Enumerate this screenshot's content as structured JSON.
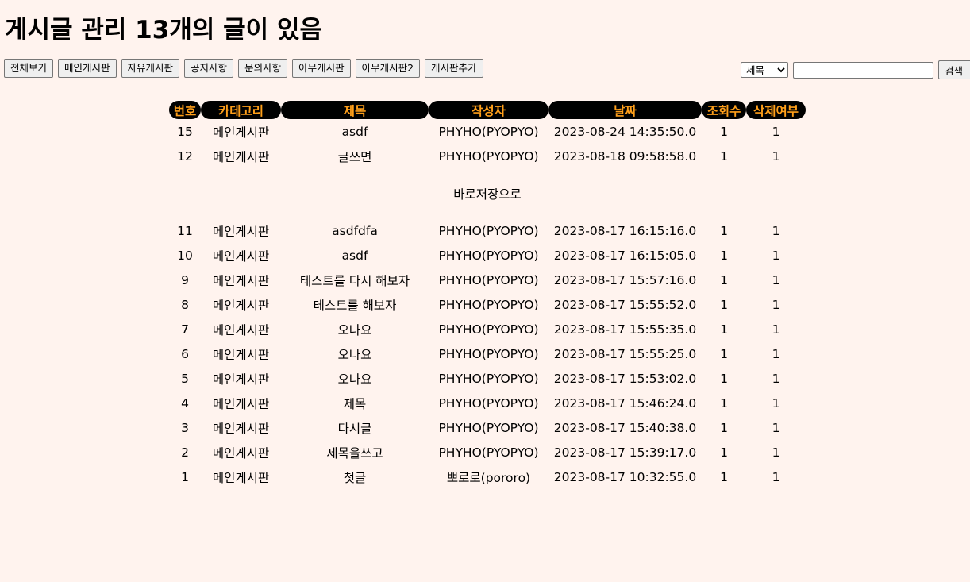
{
  "page": {
    "title": "게시글 관리 13개의 글이 있음"
  },
  "toolbar": {
    "buttons": [
      "전체보기",
      "메인게시판",
      "자유게시판",
      "공지사항",
      "문의사항",
      "아무게시판",
      "아무게시판2",
      "게시판추가"
    ]
  },
  "search": {
    "selected_option": "제목",
    "query": "",
    "button_label": "검색"
  },
  "table": {
    "headers": [
      "번호",
      "카테고리",
      "제목",
      "작성자",
      "날짜",
      "조회수",
      "삭제여부"
    ],
    "rows_top": [
      [
        "15",
        "메인게시판",
        "asdf",
        "PHYHO(PYOPYO)",
        "2023-08-24 14:35:50.0",
        "1",
        "1"
      ],
      [
        "12",
        "메인게시판",
        "글쓰면",
        "PHYHO(PYOPYO)",
        "2023-08-18 09:58:58.0",
        "1",
        "1"
      ]
    ],
    "note": "바로저장으로",
    "rows_bottom": [
      [
        "11",
        "메인게시판",
        "asdfdfa",
        "PHYHO(PYOPYO)",
        "2023-08-17 16:15:16.0",
        "1",
        "1"
      ],
      [
        "10",
        "메인게시판",
        "asdf",
        "PHYHO(PYOPYO)",
        "2023-08-17 16:15:05.0",
        "1",
        "1"
      ],
      [
        "9",
        "메인게시판",
        "테스트를 다시 해보자",
        "PHYHO(PYOPYO)",
        "2023-08-17 15:57:16.0",
        "1",
        "1"
      ],
      [
        "8",
        "메인게시판",
        "테스트를 해보자",
        "PHYHO(PYOPYO)",
        "2023-08-17 15:55:52.0",
        "1",
        "1"
      ],
      [
        "7",
        "메인게시판",
        "오나요",
        "PHYHO(PYOPYO)",
        "2023-08-17 15:55:35.0",
        "1",
        "1"
      ],
      [
        "6",
        "메인게시판",
        "오나요",
        "PHYHO(PYOPYO)",
        "2023-08-17 15:55:25.0",
        "1",
        "1"
      ],
      [
        "5",
        "메인게시판",
        "오나요",
        "PHYHO(PYOPYO)",
        "2023-08-17 15:53:02.0",
        "1",
        "1"
      ],
      [
        "4",
        "메인게시판",
        "제목",
        "PHYHO(PYOPYO)",
        "2023-08-17 15:46:24.0",
        "1",
        "1"
      ],
      [
        "3",
        "메인게시판",
        "다시글",
        "PHYHO(PYOPYO)",
        "2023-08-17 15:40:38.0",
        "1",
        "1"
      ],
      [
        "2",
        "메인게시판",
        "제목을쓰고",
        "PHYHO(PYOPYO)",
        "2023-08-17 15:39:17.0",
        "1",
        "1"
      ],
      [
        "1",
        "메인게시판",
        "첫글",
        "뽀로로(pororo)",
        "2023-08-17 10:32:55.0",
        "1",
        "1"
      ]
    ]
  },
  "colors": {
    "background": "#fff3ee",
    "header_bg": "#000000",
    "header_text": "#ff9f1a"
  }
}
